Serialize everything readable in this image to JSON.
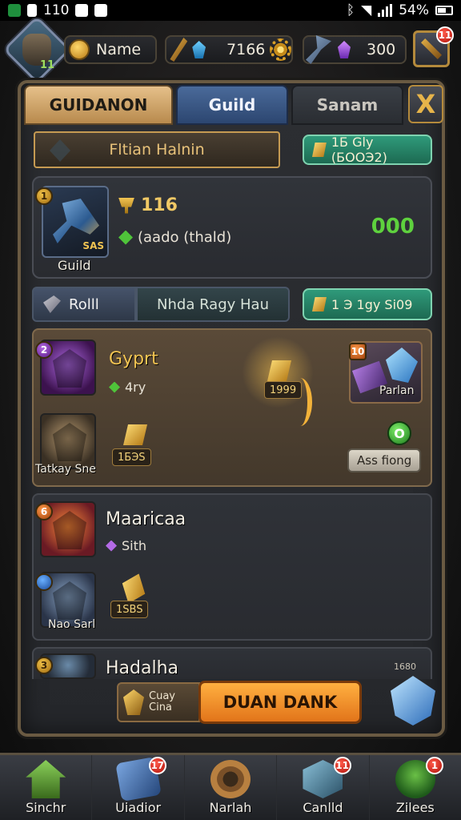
{
  "status_bar": {
    "left_text": "110",
    "battery": "54%"
  },
  "top_bar": {
    "player_level": "11",
    "name_label": "Name",
    "currency_1": "7166",
    "currency_2": "300",
    "settings_badge": "11"
  },
  "tabs": [
    {
      "label": "GUIDANON"
    },
    {
      "label": "Guild"
    },
    {
      "label": "Sanam"
    }
  ],
  "close_label": "X",
  "banner": {
    "title": "Fltian Halnin",
    "right_pill": "1Б Gly (БООЭ2)"
  },
  "guild_card": {
    "level_badge": "1",
    "icon_level": "SAS",
    "caption": "Guild",
    "trophy_value": "116",
    "status_text": "(aado (thald)",
    "green_value": "000"
  },
  "filter": {
    "first": "Rolll",
    "second": "Nhda Ragy Hau",
    "pill": "1 Э 1gy Si09"
  },
  "members": [
    {
      "name": "Gyprt",
      "sub": "4ry",
      "badge": "2",
      "second_label": "Tatkay Sne",
      "ingot_value": "1БЭS",
      "glow_value": "1999",
      "item_badge": "10",
      "item_label": "Parlan",
      "orb_label": "O",
      "assign_label": "Ass fiong"
    },
    {
      "name": "Maaricaa",
      "sub": "Sith",
      "badge": "6",
      "second_label": "Nao Sarl",
      "ingot_value": "1SBS"
    },
    {
      "name": "Hadalha",
      "badge": "3"
    }
  ],
  "bottom_action": {
    "chip_line_1": "Cuay",
    "chip_line_2": "Cina",
    "main_label": "DUAN DANK",
    "corner_label": "1680"
  },
  "nav": [
    {
      "label": "Sinchr",
      "badge": ""
    },
    {
      "label": "Uiadior",
      "badge": "17"
    },
    {
      "label": "Narlah",
      "badge": ""
    },
    {
      "label": "Canlld",
      "badge": "11"
    },
    {
      "label": "Zilees",
      "badge": "1"
    }
  ],
  "colors": {
    "accent_gold": "#f2c452",
    "action_orange": "#e2741a",
    "tab_blue": "#2c4670",
    "green_value": "#5ed13e"
  }
}
